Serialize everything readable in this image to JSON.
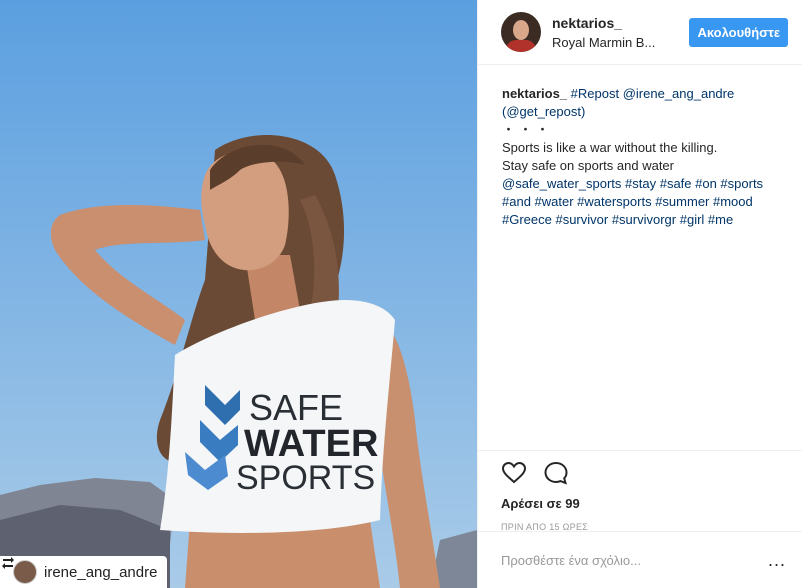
{
  "post": {
    "author": {
      "username": "nektarios_",
      "location": "Royal Marmin B..."
    },
    "follow_label": "Ακολουθήστε",
    "caption": {
      "username": "nektarios_",
      "line1_tags": "#Repost @irene_ang_andre",
      "line2": "(@get_repost)",
      "dots": "・・・",
      "line3": "Sports is like a war without the killing.",
      "line4": "Stay safe on sports and water",
      "line5": "@safe_water_sports #stay #safe #on #sports",
      "line6": "#and #water #watersports #summer #mood",
      "line7": "#Greece #survivor #survivorgr #girl #me"
    },
    "likes": "Αρέσει σε 99",
    "time_ago": "ΠΡΙΝ ΑΠΟ 15 ΩΡΕΣ",
    "comment_placeholder": "Προσθέστε ένα σχόλιο...",
    "more_label": "...",
    "image": {
      "shirt_text_line1": "SAFE",
      "shirt_text_line2": "WATER",
      "shirt_text_line3": "SPORTS",
      "repost_user": "irene_ang_andre"
    }
  },
  "icons": {
    "heart": "heart-icon",
    "comment": "comment-icon",
    "repost": "repost-icon",
    "more": "more-options-icon"
  },
  "colors": {
    "follow_button": "#3897f0",
    "link": "#003569",
    "sky": "#6aa6dc"
  }
}
